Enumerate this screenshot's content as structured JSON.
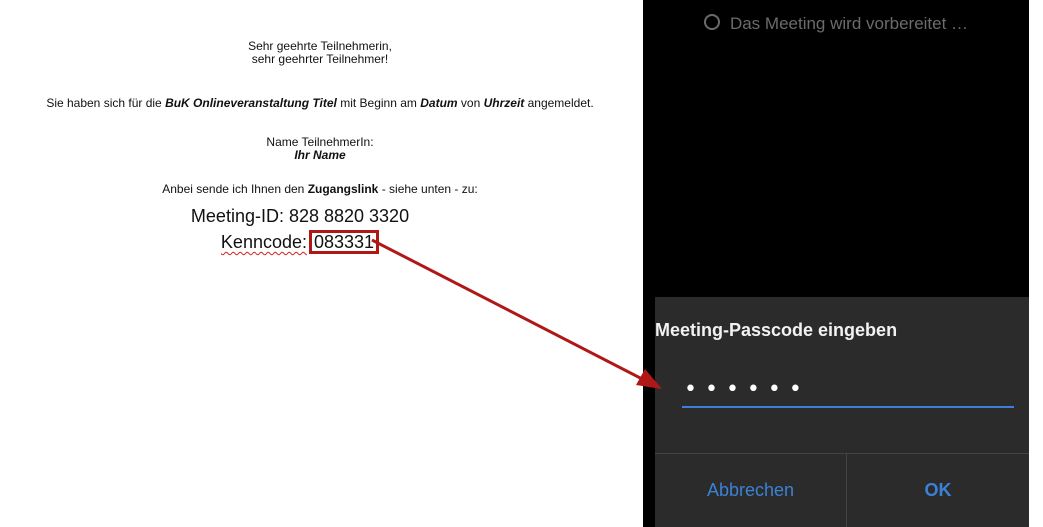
{
  "letter": {
    "salutation_1": "Sehr geehrte Teilnehmerin,",
    "salutation_2": "sehr geehrter Teilnehmer!",
    "body_pre": "Sie haben sich für die ",
    "event_title": "BuK Onlineveranstaltung Titel",
    "body_mid1": " mit Beginn am ",
    "date": "Datum",
    "body_mid2": " von ",
    "time": "Uhrzeit",
    "body_post": " angemeldet.",
    "name_label": "Name TeilnehmerIn:",
    "name_value": "Ihr Name",
    "link_pre": "Anbei sende ich Ihnen den ",
    "link_word": "Zugangslink",
    "link_post": " - siehe unten - zu:",
    "meeting_id_label": "Meeting-ID: 828 8820 3320",
    "kenncode_label": "Kenncode:",
    "kenncode_value": "083331"
  },
  "phone": {
    "status_text": "Das Meeting wird vorbereitet …",
    "dialog": {
      "title": "Meeting-Passcode eingeben",
      "passcode_value": "••••••",
      "cancel_label": "Abbrechen",
      "ok_label": "OK"
    }
  },
  "colors": {
    "annotation_red": "#b01818",
    "accent_blue": "#3b82d6",
    "dialog_bg": "#2b2b2b",
    "phone_bg": "#000000"
  }
}
